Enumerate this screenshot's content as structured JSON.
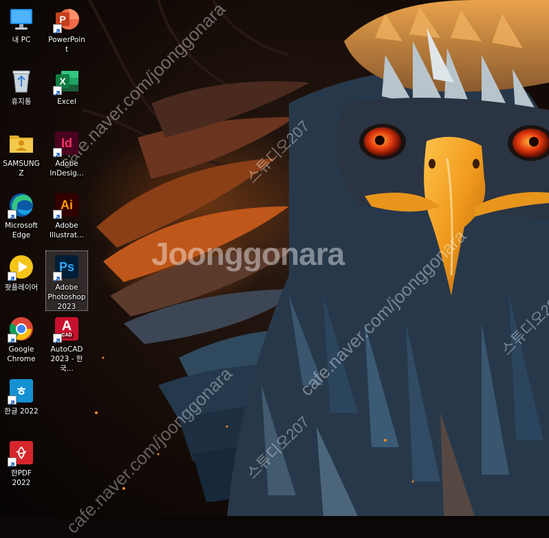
{
  "desktop": {
    "icons": [
      {
        "label": "내 PC",
        "icon": "monitor-icon"
      },
      {
        "label": "휴지통",
        "icon": "recycle-bin-icon"
      },
      {
        "label": "SAMSUNG Z",
        "icon": "user-folder-icon"
      },
      {
        "label": "Microsoft Edge",
        "icon": "edge-icon"
      },
      {
        "label": "팟플레이어",
        "icon": "potplayer-icon"
      },
      {
        "label": "Google Chrome",
        "icon": "chrome-icon"
      },
      {
        "label": "한글 2022",
        "icon": "hangul-icon"
      },
      {
        "label": "한PDF 2022",
        "icon": "hanpdf-icon"
      },
      {
        "label": "PowerPoint",
        "icon": "powerpoint-icon"
      },
      {
        "label": "Excel",
        "icon": "excel-icon"
      },
      {
        "label": "Adobe InDesig...",
        "icon": "indesign-icon"
      },
      {
        "label": "Adobe Illustrat...",
        "icon": "illustrator-icon"
      },
      {
        "label": "Adobe Photoshop 2023",
        "icon": "photoshop-icon",
        "selected": true
      },
      {
        "label": "AutoCAD 2023 - 한국...",
        "icon": "autocad-icon"
      }
    ],
    "tile_text": {
      "powerpoint": "P",
      "excel": "X",
      "indesign": "Id",
      "illustrator": "Ai",
      "photoshop": "Ps",
      "autocad": "A",
      "autocad_badge": "CAD",
      "hangul": "ㅎ"
    },
    "colors": {
      "powerpoint": "#c43e1c",
      "excel": "#107c41",
      "indesign": "#49021f",
      "indesign_fg": "#ff3366",
      "illustrator": "#330000",
      "illustrator_fg": "#ff9a00",
      "photoshop": "#001e36",
      "photoshop_fg": "#31a8ff",
      "autocad": "#c8102e",
      "edge": "#0c8ad8",
      "potplayer": "#f5c518",
      "hangul": "#1590d2",
      "hanpdf": "#d6262c",
      "folder": "#f2c94c"
    }
  },
  "watermark": {
    "brand": "Joonggonara",
    "url": "cafe.naver.com/joonggonara",
    "studio": "스튜디오207"
  }
}
